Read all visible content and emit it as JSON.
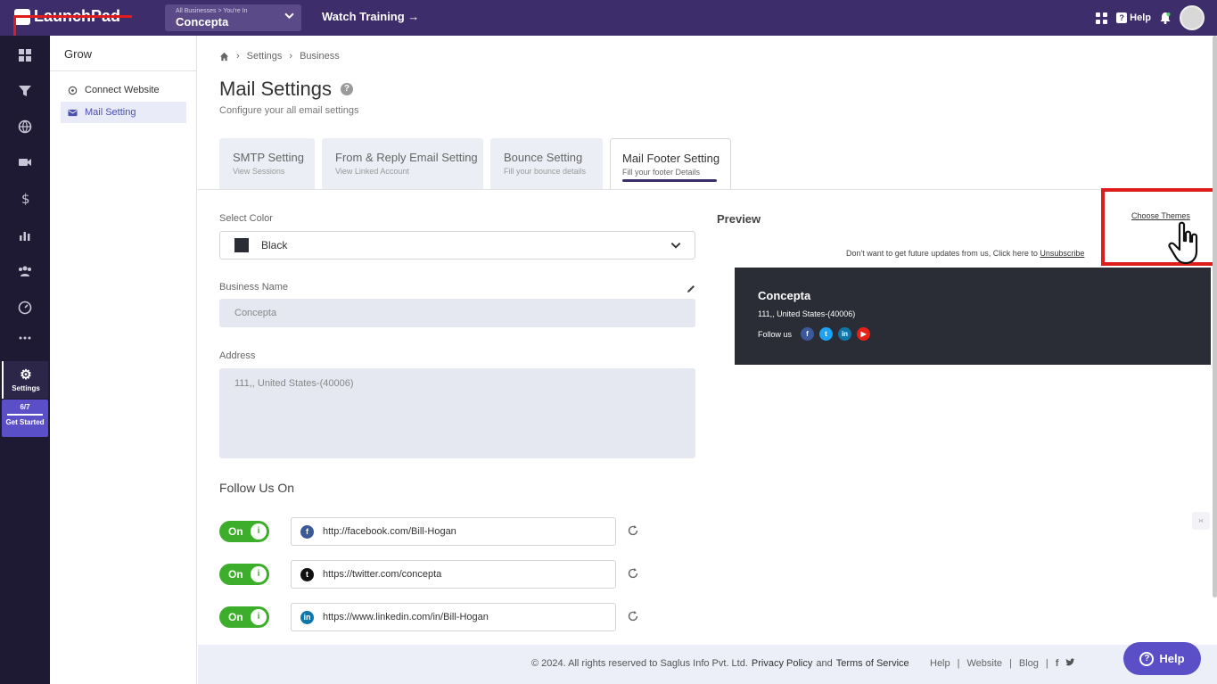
{
  "topbar": {
    "logo_text": "LaunchPad",
    "business_small": "All Businesses > You're In",
    "business_name": "Concepta",
    "watch_training": "Watch Training →",
    "help": "Help"
  },
  "rail": {
    "settings_label": "Settings",
    "progress": "6/7",
    "get_started": "Get Started"
  },
  "subnav": {
    "title": "Grow",
    "items": [
      {
        "label": "Connect Website"
      },
      {
        "label": "Mail Setting"
      }
    ]
  },
  "breadcrumb": [
    "Settings",
    "Business"
  ],
  "page": {
    "title": "Mail Settings",
    "subtitle": "Configure your all email settings"
  },
  "tabs": [
    {
      "title": "SMTP Setting",
      "sub": "View Sessions"
    },
    {
      "title": "From & Reply Email Setting",
      "sub": "View Linked Account"
    },
    {
      "title": "Bounce Setting",
      "sub": "Fill your bounce details"
    },
    {
      "title": "Mail Footer Setting",
      "sub": "Fill your footer Details"
    }
  ],
  "form": {
    "select_color_label": "Select Color",
    "select_color_value": "Black",
    "select_color_swatch": "#2a2d36",
    "business_name_label": "Business Name",
    "business_name_value": "Concepta",
    "address_label": "Address",
    "address_value": "111,, United States-(40006)",
    "follow_title": "Follow Us On",
    "toggle_on": "On",
    "socials": [
      {
        "url": "http://facebook.com/Bill-Hogan",
        "icon": "facebook-icon",
        "color": "#3b5998",
        "glyph": "f"
      },
      {
        "url": "https://twitter.com/concepta",
        "icon": "twitter-icon",
        "color": "#111111",
        "glyph": "t"
      },
      {
        "url": "https://www.linkedin.com/in/Bill-Hogan",
        "icon": "linkedin-icon",
        "color": "#0e76a8",
        "glyph": "in"
      }
    ]
  },
  "preview": {
    "title": "Preview",
    "choose_themes": "Choose Themes",
    "unsub_text": "Don't want to get future updates from us, Click here to",
    "unsub_link": "Unsubscribe",
    "name": "Concepta",
    "address": "111,, United States-(40006)",
    "follow_us": "Follow us"
  },
  "footer": {
    "copyright": "© 2024. All rights reserved to Saglus Info Pvt. Ltd.",
    "privacy": "Privacy Policy",
    "and": "and",
    "terms": "Terms of Service",
    "help": "Help",
    "website": "Website",
    "blog": "Blog"
  },
  "help_button": "Help",
  "colors": {
    "topbar": "#3d2d6b",
    "rail": "#1e1a33",
    "accent": "#5b4fc7",
    "toggle": "#3dae2b",
    "annotation_red": "#e01b1b"
  }
}
